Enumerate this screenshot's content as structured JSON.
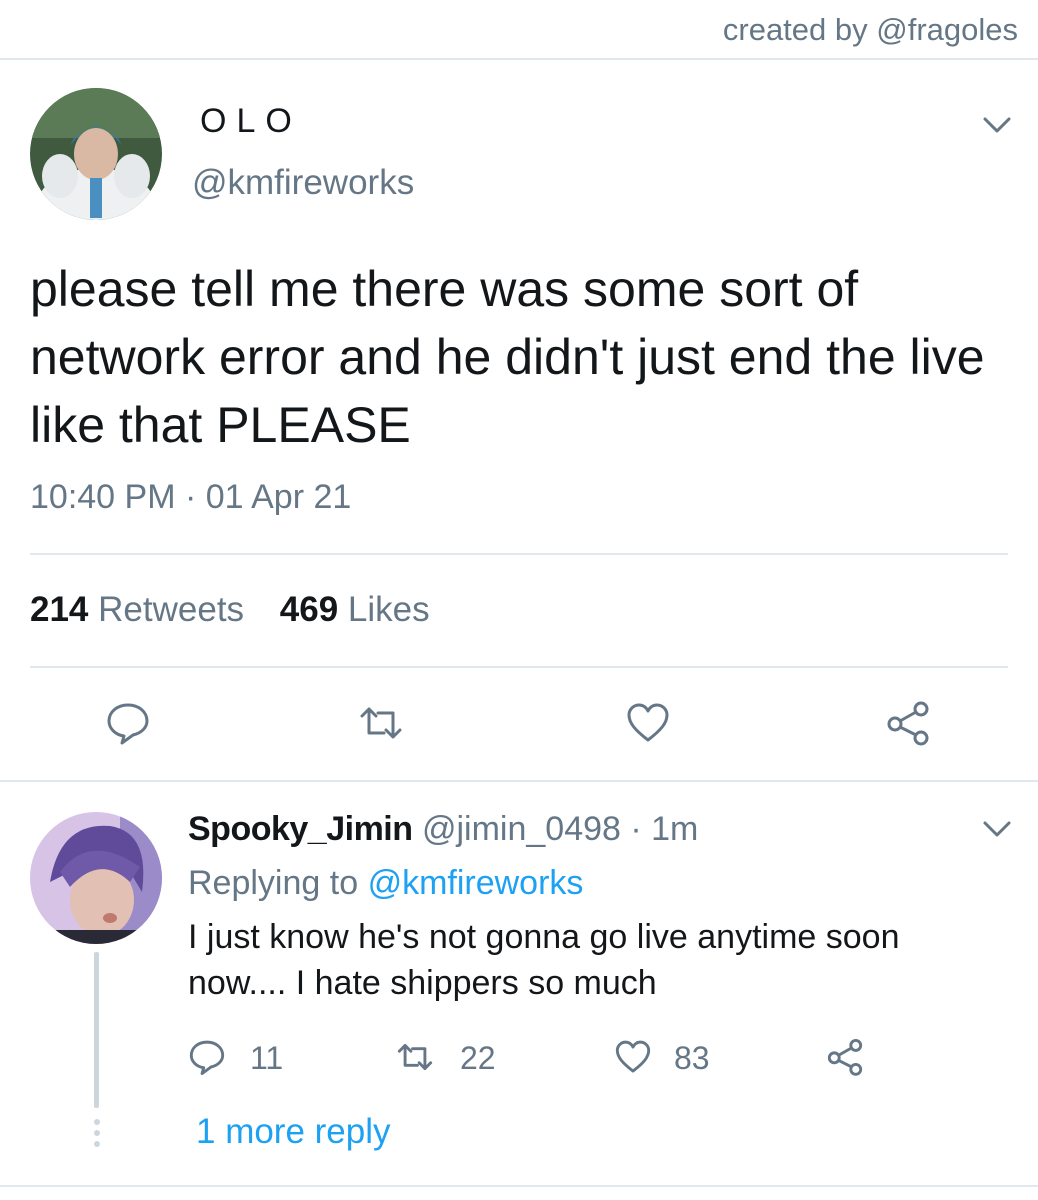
{
  "credit": "created by @fragoles",
  "tweet": {
    "display_name": "OLO",
    "handle": "@kmfireworks",
    "text": "please tell me there was some sort of network error and he didn't just end the live like that PLEASE",
    "timestamp": "10:40 PM · 01 Apr 21",
    "retweets_count": "214",
    "retweets_label": "Retweets",
    "likes_count": "469",
    "likes_label": "Likes"
  },
  "actions": {
    "icons": [
      "reply-icon",
      "retweet-icon",
      "like-icon",
      "share-icon"
    ]
  },
  "reply": {
    "display_name": "Spooky_Jimin",
    "handle_time": "@jimin_0498 · 1m",
    "replying_prefix": "Replying to",
    "replying_to": "@kmfireworks",
    "text": "I just know he's not gonna go live anytime soon now.... I hate shippers so much",
    "reply_count": "11",
    "retweet_count": "22",
    "like_count": "83",
    "more_replies": "1 more reply"
  },
  "colors": {
    "text": "#14171a",
    "muted": "#657786",
    "link": "#1da1f2",
    "divider": "#e1e8ed",
    "thread_line": "#ccd6dd"
  }
}
